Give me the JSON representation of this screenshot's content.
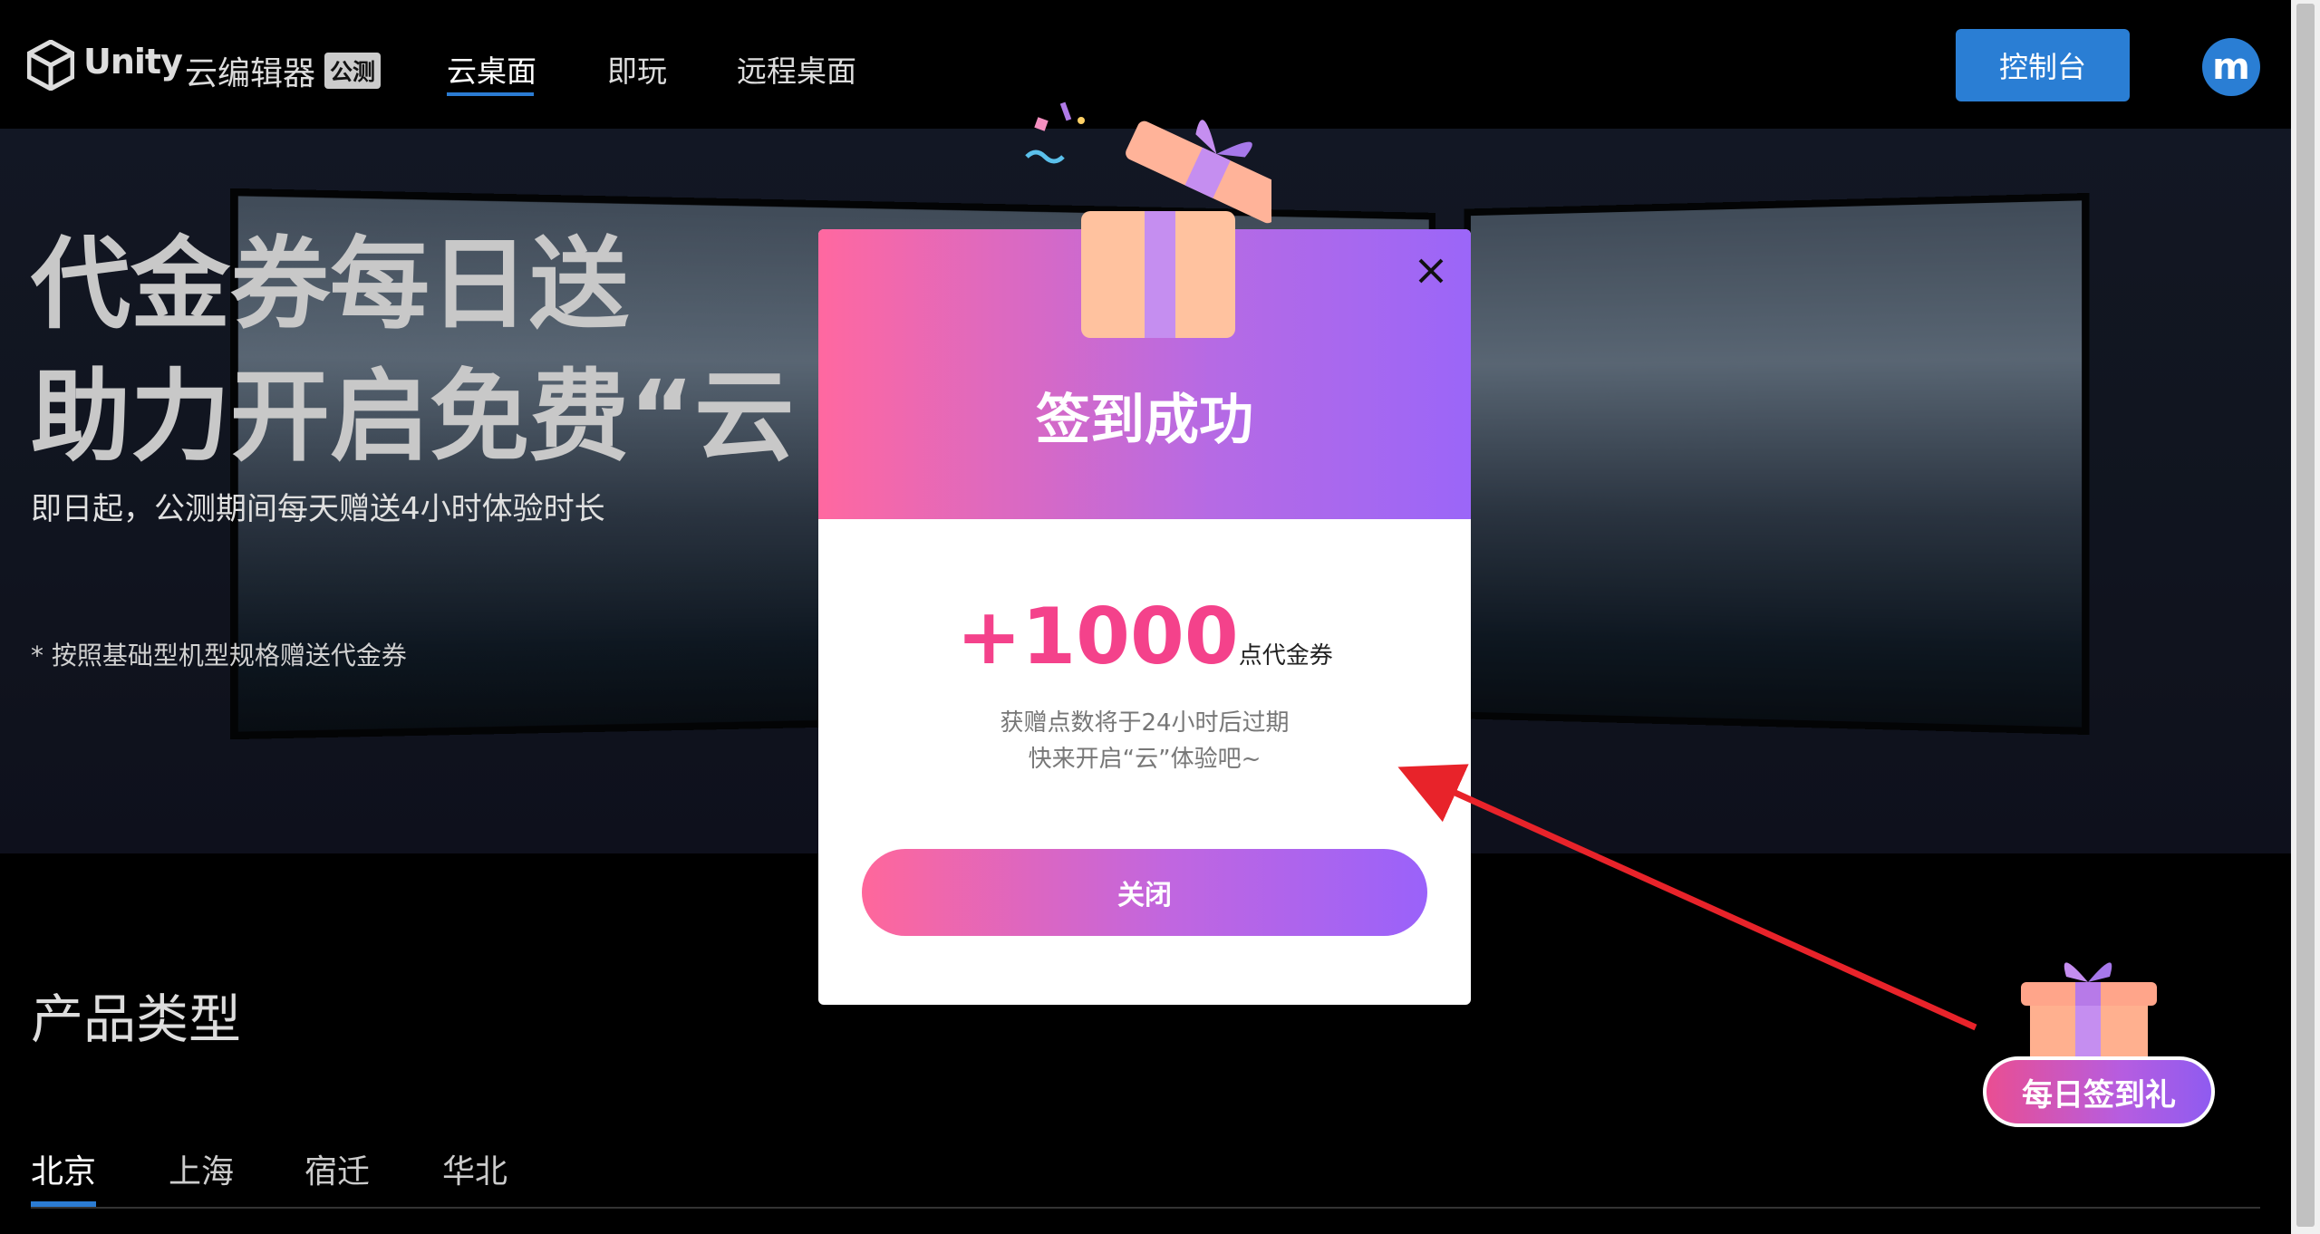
{
  "header": {
    "brand": "Unity",
    "product": "云编辑器",
    "badge": "公测",
    "nav": [
      {
        "label": "云桌面",
        "active": true
      },
      {
        "label": "即玩",
        "active": false
      },
      {
        "label": "远程桌面",
        "active": false
      }
    ],
    "console_label": "控制台",
    "avatar_letter": "m"
  },
  "hero": {
    "title_line1": "代金券每日送",
    "title_line2": "助力开启免费“云",
    "subtitle": "即日起，公测期间每天赠送4小时体验时长",
    "note": "* 按照基础型机型规格赠送代金券"
  },
  "products": {
    "title": "产品类型",
    "regions": [
      {
        "label": "北京",
        "active": true
      },
      {
        "label": "上海",
        "active": false
      },
      {
        "label": "宿迁",
        "active": false
      },
      {
        "label": "华北",
        "active": false
      }
    ]
  },
  "modal": {
    "title": "签到成功",
    "points": "+1000",
    "points_unit": "点代金券",
    "info_line1": "获赠点数将于24小时后过期",
    "info_line2": "快来开启“云”体验吧~",
    "close_label": "关闭"
  },
  "checkin_widget": {
    "label": "每日签到礼"
  },
  "colors": {
    "accent_blue": "#2a7ed4",
    "pink": "#f4428b",
    "purple": "#9b66f8",
    "annotation_arrow": "#e8232a"
  }
}
